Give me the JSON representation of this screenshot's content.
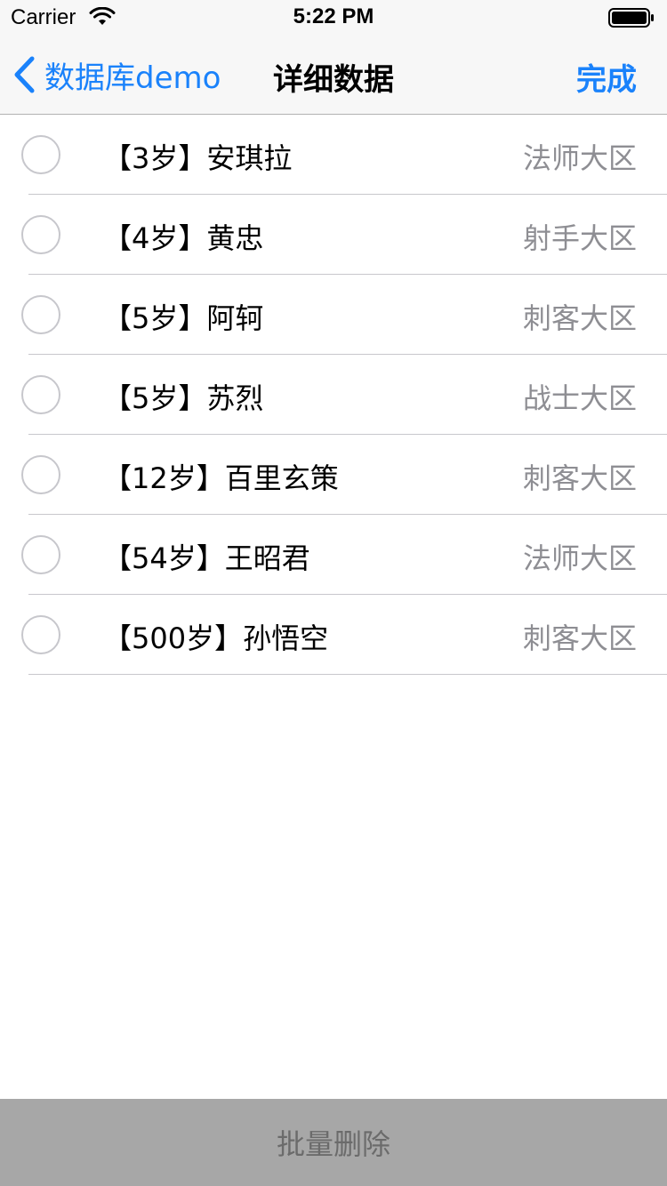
{
  "status_bar": {
    "carrier": "Carrier",
    "time": "5:22 PM",
    "wifi_icon": "wifi-icon",
    "battery_icon": "battery-icon"
  },
  "nav": {
    "back_label": "数据库demo",
    "back_icon": "chevron-left-icon",
    "title": "详细数据",
    "done_label": "完成"
  },
  "rows": [
    {
      "title": "【3岁】安琪拉",
      "detail": "法师大区"
    },
    {
      "title": "【4岁】黄忠",
      "detail": "射手大区"
    },
    {
      "title": "【5岁】阿轲",
      "detail": "刺客大区"
    },
    {
      "title": "【5岁】苏烈",
      "detail": "战士大区"
    },
    {
      "title": "【12岁】百里玄策",
      "detail": "刺客大区"
    },
    {
      "title": "【54岁】王昭君",
      "detail": "法师大区"
    },
    {
      "title": "【500岁】孙悟空",
      "detail": "刺客大区"
    }
  ],
  "bottom": {
    "label": "批量删除"
  },
  "colors": {
    "accent": "#1a82fb",
    "detail_text": "#8e8e93",
    "bar_background": "#f7f7f7",
    "bottom_button": "#a7a7a7"
  }
}
